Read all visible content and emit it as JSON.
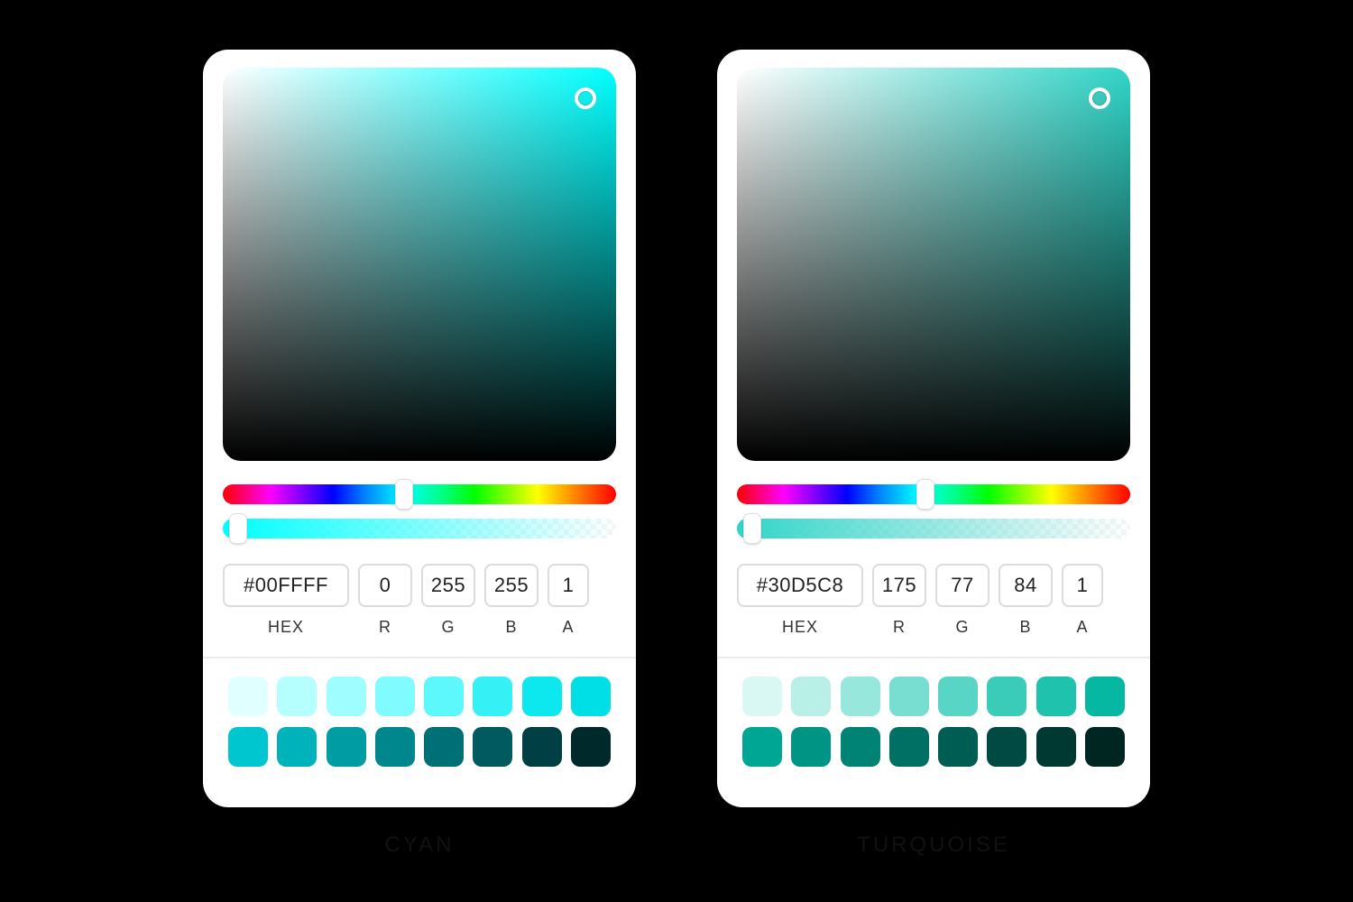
{
  "pickers": [
    {
      "caption": "CYAN",
      "main_color": "#00FFFF",
      "hex": "#00FFFF",
      "r": "0",
      "g": "255",
      "b": "255",
      "a": "1",
      "labels": {
        "hex": "HEX",
        "r": "R",
        "g": "G",
        "b": "B",
        "a": "A"
      },
      "hue_thumb_pct": 46,
      "alpha_thumb_pct": 4,
      "swatches_light": [
        "#e0ffff",
        "#b5ffff",
        "#9ffcff",
        "#80fbff",
        "#5cf8fc",
        "#35f1f5",
        "#0ce8ee",
        "#00dfe6"
      ],
      "swatches_dark": [
        "#00c7cf",
        "#00b3bb",
        "#009ca4",
        "#00878e",
        "#007077",
        "#005a60",
        "#003f44",
        "#00292b"
      ]
    },
    {
      "caption": "TURQUOISE",
      "main_color": "#30D5C8",
      "hex": "#30D5C8",
      "r": "175",
      "g": "77",
      "b": "84",
      "a": "1",
      "labels": {
        "hex": "HEX",
        "r": "R",
        "g": "G",
        "b": "B",
        "a": "A"
      },
      "hue_thumb_pct": 48,
      "alpha_thumb_pct": 4,
      "swatches_light": [
        "#d9f7f3",
        "#b8efe7",
        "#97e7dc",
        "#77ded1",
        "#58d5c5",
        "#3accb9",
        "#1ec2ad",
        "#06b7a1"
      ],
      "swatches_dark": [
        "#00a694",
        "#009484",
        "#008274",
        "#006f64",
        "#005d53",
        "#004a43",
        "#003832",
        "#002622"
      ]
    }
  ]
}
